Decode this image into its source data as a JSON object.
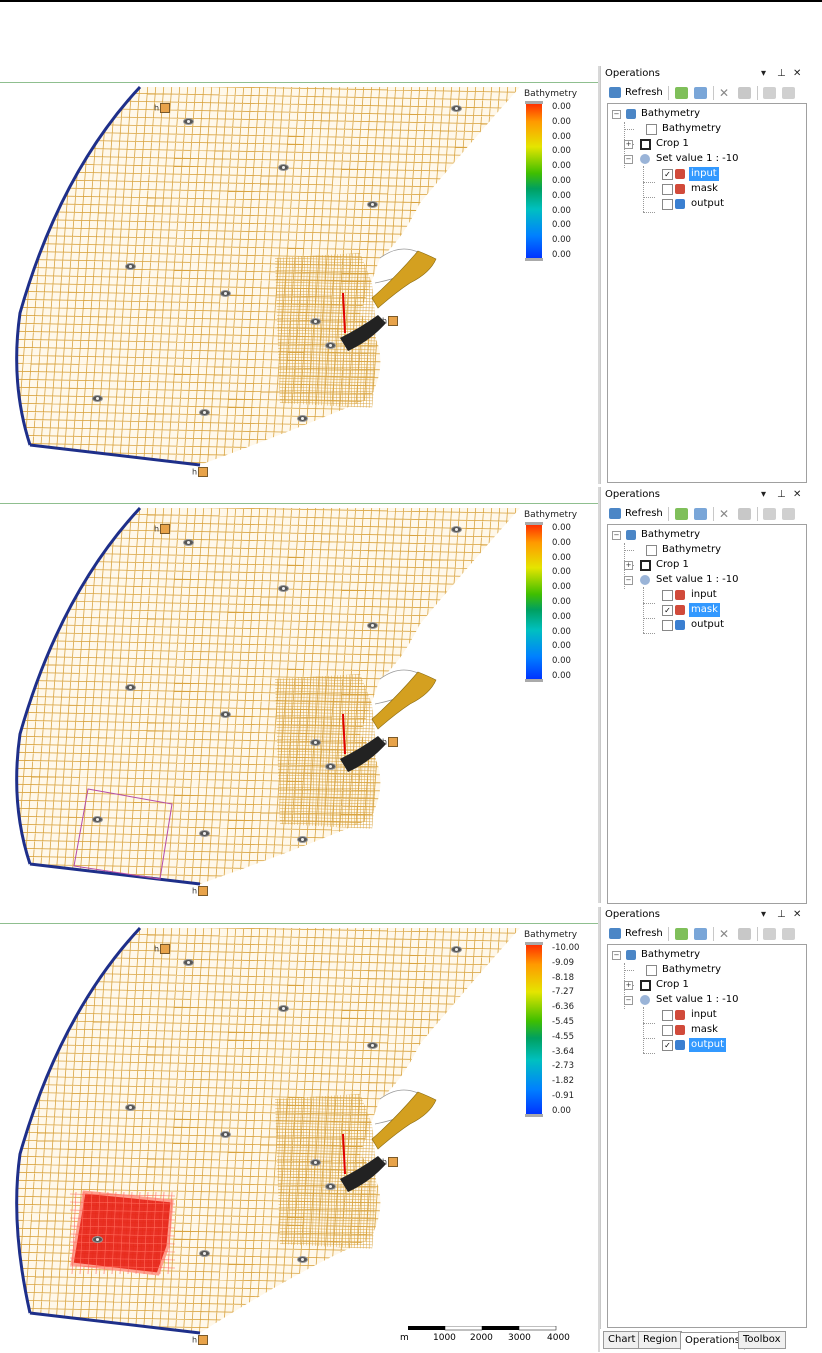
{
  "panels": [
    {
      "legend_title": "Bathymetry",
      "legend_values": [
        "0.00",
        "0.00",
        "0.00",
        "0.00",
        "0.00",
        "0.00",
        "0.00",
        "0.00",
        "0.00",
        "0.00",
        "0.00"
      ],
      "selected_node": "input"
    },
    {
      "legend_title": "Bathymetry",
      "legend_values": [
        "0.00",
        "0.00",
        "0.00",
        "0.00",
        "0.00",
        "0.00",
        "0.00",
        "0.00",
        "0.00",
        "0.00",
        "0.00"
      ],
      "selected_node": "mask"
    },
    {
      "legend_title": "Bathymetry",
      "legend_values": [
        "-10.00",
        "-9.09",
        "-8.18",
        "-7.27",
        "-6.36",
        "-5.45",
        "-4.55",
        "-3.64",
        "-2.73",
        "-1.82",
        "-0.91",
        "0.00"
      ],
      "selected_node": "output"
    }
  ],
  "operations": {
    "title": "Operations",
    "refresh": "Refresh",
    "tree": {
      "root": "Bathymetry",
      "child_bathymetry": "Bathymetry",
      "crop": "Crop 1",
      "setvalue": "Set value 1 : -10",
      "input": "input",
      "mask": "mask",
      "output": "output"
    }
  },
  "tabs": [
    "Chart",
    "Region",
    "Operations",
    "Toolbox"
  ],
  "active_tab": "Operations",
  "scale": {
    "unit": "m",
    "ticks": [
      "1000",
      "2000",
      "3000",
      "4000"
    ]
  },
  "colors": {
    "grid": "#d9a441",
    "boundary": "#1e2f8a",
    "selection": "#3399ff",
    "mask_outline": "#b44ca8",
    "fill_red": "#e8261a"
  }
}
